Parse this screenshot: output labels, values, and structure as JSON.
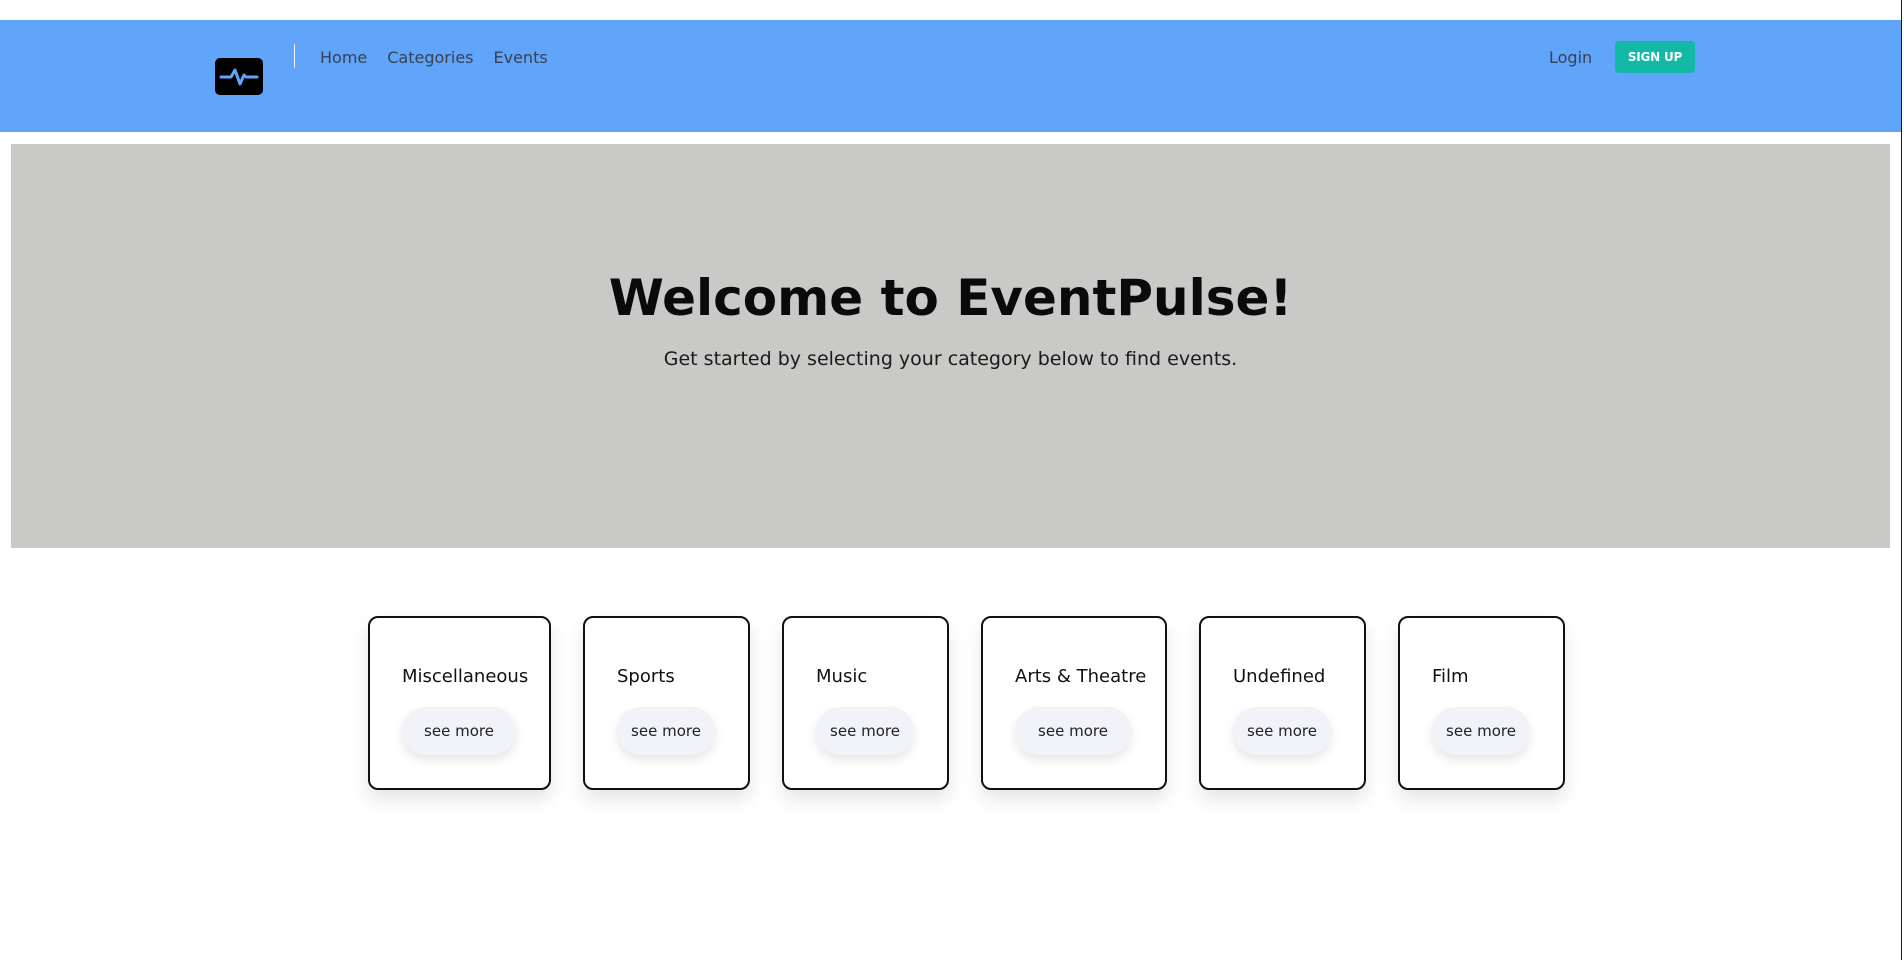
{
  "header": {
    "logo_icon": "pulse-icon",
    "nav": [
      "Home",
      "Categories",
      "Events"
    ],
    "login_label": "Login",
    "signup_label": "SIGN UP"
  },
  "hero": {
    "title": "Welcome to EventPulse!",
    "subtitle": "Get started by selecting your category below to find events."
  },
  "categories": [
    {
      "name": "Miscellaneous",
      "button": "see more"
    },
    {
      "name": "Sports",
      "button": "see more"
    },
    {
      "name": "Music",
      "button": "see more"
    },
    {
      "name": "Arts & Theatre",
      "button": "see more"
    },
    {
      "name": "Undefined",
      "button": "see more"
    },
    {
      "name": "Film",
      "button": "see more"
    }
  ],
  "colors": {
    "header_bg": "#60a5fa",
    "hero_bg": "#c9c9c7",
    "signup_bg": "#14b8a6",
    "card_border": "#111111",
    "card_button_bg": "#f1f3f9"
  }
}
